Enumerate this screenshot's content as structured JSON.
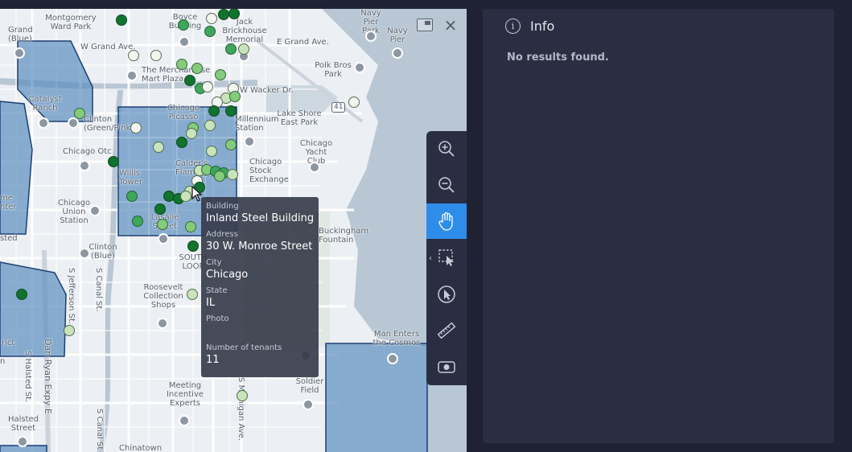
{
  "map": {
    "labels": {
      "montgomery": "Montgomery\nWard Park",
      "boyce": "Boyce\nBuilding",
      "jack_brickhouse": "Jack\nBrickhouse\nMemorial",
      "navy_pier_park": "Navy\nPier\nPark",
      "navy_pier": "Navy\nPier",
      "grand_blue": "Grand\n(Blue)",
      "w_grand_ave": "W Grand Ave.",
      "e_grand_ave": "E Grand Ave.",
      "polk_bros": "Polk Bros\nPark",
      "merchandise_mart": "The Merchandise\nMart Plaza",
      "w_wacker": "W Wacker Dr.",
      "catalyst_ranch": "Catalyst\nRanch",
      "chicago_picasso": "Chicago\nPicasso",
      "millennium": "Millennium\nStation",
      "lake_shore": "Lake Shore\nEast Park",
      "clinton_green": "Clinton\n(Green/Pink)",
      "chicago_otc": "Chicago Otc",
      "chicago_yacht": "Chicago\nYacht\nClub",
      "willis_tower": "Willis\nTower",
      "calders": "Calder's\nFlamingo",
      "chicago_stock": "Chicago\nStock\nExchange",
      "chicago_union": "Chicago\nUnion\nStation",
      "lasalle": "Lasalle\nStreet",
      "buckingham": "Buckingham\nFountain",
      "clinton_blue": "Clinton\n(Blue)",
      "south_loop": "SOUTH\nLOOP",
      "s_jefferson": "S Jefferson St.",
      "s_canal": "S Canal St.",
      "roosevelt": "Roosevelt\nCollection\nShops",
      "dan_ryan": "Dan Ryan Expy E",
      "s_halsted": "S Halsted St.",
      "man_enters": "Man Enters\nthe Cosmos",
      "soldier_field": "Soldier\nField",
      "meeting_incentive": "Meeting\nIncentive\nExperts",
      "halsted_street": "Halsted\nStreet",
      "s_canal_2": "S Canal St.",
      "michigan_ave": "S Michigan Ave.",
      "chinatown": "Chinatown",
      "lake_label": "me\nnter",
      "district": "rict",
      "sted": "sted",
      "jn": "n",
      "route_41": "41",
      "vidson": "Hidson"
    }
  },
  "tooltip": {
    "building_label": "Building",
    "building": "Inland Steel Building",
    "address_label": "Address",
    "address": "30 W. Monroe Street",
    "city_label": "City",
    "city": "Chicago",
    "state_label": "State",
    "state": "IL",
    "photo_label": "Photo",
    "tenants_label": "Number of tenants",
    "tenants": "11"
  },
  "toolbar": {
    "tools": [
      "zoom-in",
      "zoom-out",
      "pan",
      "select-area",
      "select-feature",
      "measure",
      "screenshot"
    ],
    "active": "pan",
    "active_color": "#2f8dea"
  },
  "info": {
    "title": "Info",
    "message": "No results found."
  },
  "colors": {
    "zone_fill": "#5b8fbf",
    "zone_stroke": "#1d3f74",
    "water": "#b9c7d4",
    "panel": "#2a2e42",
    "background": "#1f2233"
  }
}
